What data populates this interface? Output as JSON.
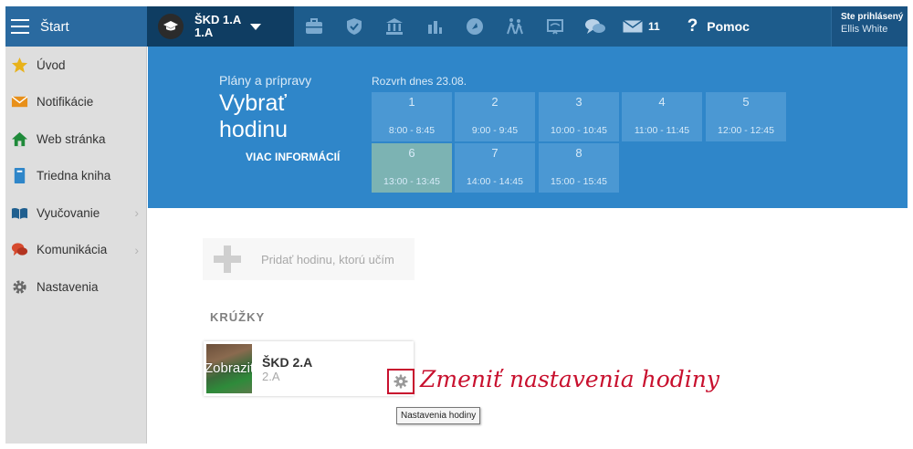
{
  "topbar": {
    "start_label": "Štart",
    "class_name_line1": "ŠKD 1.A",
    "class_name_line2": "1.A",
    "nav_icons": [
      "briefcase-icon",
      "shield-icon",
      "bank-icon",
      "bar-chart-icon",
      "rocket-icon",
      "people-walking-icon",
      "projector-icon",
      "chat-icon"
    ],
    "mail_count": "11",
    "help_label": "Pomoc",
    "user_line1": "Ste prihlásený",
    "user_line2": "Ellis White"
  },
  "sidebar": {
    "items": [
      {
        "label": "Úvod",
        "icon": "star-icon",
        "has_sub": false
      },
      {
        "label": "Notifikácie",
        "icon": "envelope-icon",
        "has_sub": false
      },
      {
        "label": "Web stránka",
        "icon": "home-icon",
        "has_sub": false
      },
      {
        "label": "Triedna kniha",
        "icon": "book-icon",
        "has_sub": false
      },
      {
        "label": "Vyučovanie",
        "icon": "open-book-icon",
        "has_sub": true
      },
      {
        "label": "Komunikácia",
        "icon": "chat-bubbles-icon",
        "has_sub": true
      },
      {
        "label": "Nastavenia",
        "icon": "gear-icon",
        "has_sub": false
      }
    ]
  },
  "hero": {
    "subtitle": "Plány a prípravy",
    "title": "Vybrať hodinu",
    "more_link": "VIAC INFORMÁCIÍ",
    "schedule_title": "Rozvrh dnes 23.08.",
    "slots": [
      {
        "num": "1",
        "time": "8:00 - 8:45"
      },
      {
        "num": "2",
        "time": "9:00 - 9:45"
      },
      {
        "num": "3",
        "time": "10:00 - 10:45"
      },
      {
        "num": "4",
        "time": "11:00 - 11:45"
      },
      {
        "num": "5",
        "time": "12:00 - 12:45"
      },
      {
        "num": "6",
        "time": "13:00 - 13:45",
        "active": true
      },
      {
        "num": "7",
        "time": "14:00 - 14:45"
      },
      {
        "num": "8",
        "time": "15:00 - 15:45"
      }
    ]
  },
  "content": {
    "add_label": "Pridať hodinu, ktorú učím",
    "section_heading": "KRÚŽKY",
    "card": {
      "thumb_overlay": "Zobraziť",
      "name": "ŠKD 2.A",
      "sub": "2.A"
    },
    "annotation": "Zmeniť nastavenia hodiny",
    "tooltip": "Nastavenia hodiny"
  },
  "colors": {
    "topbar": "#1d5c8c",
    "hero": "#2f86c9",
    "slot": "#4b98d3",
    "slot_active": "#7cb3b3",
    "annotation": "#c8102e"
  }
}
